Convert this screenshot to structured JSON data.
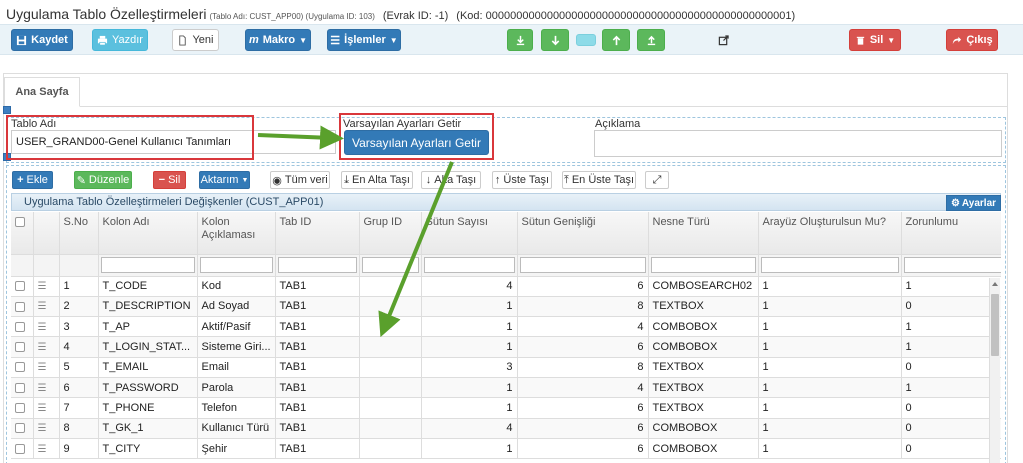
{
  "title": {
    "main": "Uygulama Tablo Özelleştirmeleri",
    "table_info": "(Tablo Adı: CUST_APP00) (Uygulama ID: 103)",
    "evrak": "(Evrak ID: -1)",
    "kod": "(Kod: 00000000000000000000000000000000000000000000000001)"
  },
  "toolbar": {
    "save": "Kaydet",
    "print": "Yazdır",
    "new": "Yeni",
    "macro": "Makro",
    "actions": "İşlemler",
    "delete": "Sil",
    "exit": "Çıkış"
  },
  "tabs": {
    "home": "Ana Sayfa"
  },
  "form": {
    "table_label": "Tablo Adı",
    "table_value": "USER_GRAND00-Genel Kullanıcı Tanımları",
    "defaults_label": "Varsayılan Ayarları Getir",
    "defaults_button": "Varsayılan Ayarları Getir",
    "description_label": "Açıklama"
  },
  "grid_toolbar": {
    "add": "Ekle",
    "edit": "Düzenle",
    "delete": "Sil",
    "export": "Aktarım",
    "all_data": "Tüm veri",
    "to_bottom": "En Alta Taşı",
    "down": "Alta Taşı",
    "up": "Üste Taşı",
    "to_top": "En Üste Taşı"
  },
  "grid": {
    "caption": "Uygulama Tablo Özelleştirmeleri Değişkenler (CUST_APP01)",
    "settings": "Ayarlar",
    "columns": [
      "S.No",
      "Kolon Adı",
      "Kolon Açıklaması",
      "Tab ID",
      "Grup ID",
      "Sütun Sayısı",
      "Sütun Genişliği",
      "Nesne Türü",
      "Arayüz Oluşturulsun Mu?",
      "Zorunlumu"
    ],
    "rows": [
      [
        "1",
        "T_CODE",
        "Kod",
        "TAB1",
        "",
        "4",
        "6",
        "COMBOSEARCH02",
        "1",
        "1"
      ],
      [
        "2",
        "T_DESCRIPTION",
        "Ad Soyad",
        "TAB1",
        "",
        "1",
        "8",
        "TEXTBOX",
        "1",
        "0"
      ],
      [
        "3",
        "T_AP",
        "Aktif/Pasif",
        "TAB1",
        "",
        "1",
        "4",
        "COMBOBOX",
        "1",
        "1"
      ],
      [
        "4",
        "T_LOGIN_STAT...",
        "Sisteme Giri...",
        "TAB1",
        "",
        "1",
        "6",
        "COMBOBOX",
        "1",
        "1"
      ],
      [
        "5",
        "T_EMAIL",
        "Email",
        "TAB1",
        "",
        "3",
        "8",
        "TEXTBOX",
        "1",
        "0"
      ],
      [
        "6",
        "T_PASSWORD",
        "Parola",
        "TAB1",
        "",
        "1",
        "4",
        "TEXTBOX",
        "1",
        "1"
      ],
      [
        "7",
        "T_PHONE",
        "Telefon",
        "TAB1",
        "",
        "1",
        "6",
        "TEXTBOX",
        "1",
        "0"
      ],
      [
        "8",
        "T_GK_1",
        "Kullanıcı Türü",
        "TAB1",
        "",
        "4",
        "6",
        "COMBOBOX",
        "1",
        "0"
      ],
      [
        "9",
        "T_CITY",
        "Şehir",
        "TAB1",
        "",
        "1",
        "6",
        "COMBOBOX",
        "1",
        "0"
      ]
    ]
  },
  "colors": {
    "primary": "#337ab7",
    "success": "#5cb85c",
    "danger": "#d9534f",
    "info": "#5bc0de",
    "annotation_red": "#d9373b",
    "annotation_arrow": "#5aa02c"
  }
}
